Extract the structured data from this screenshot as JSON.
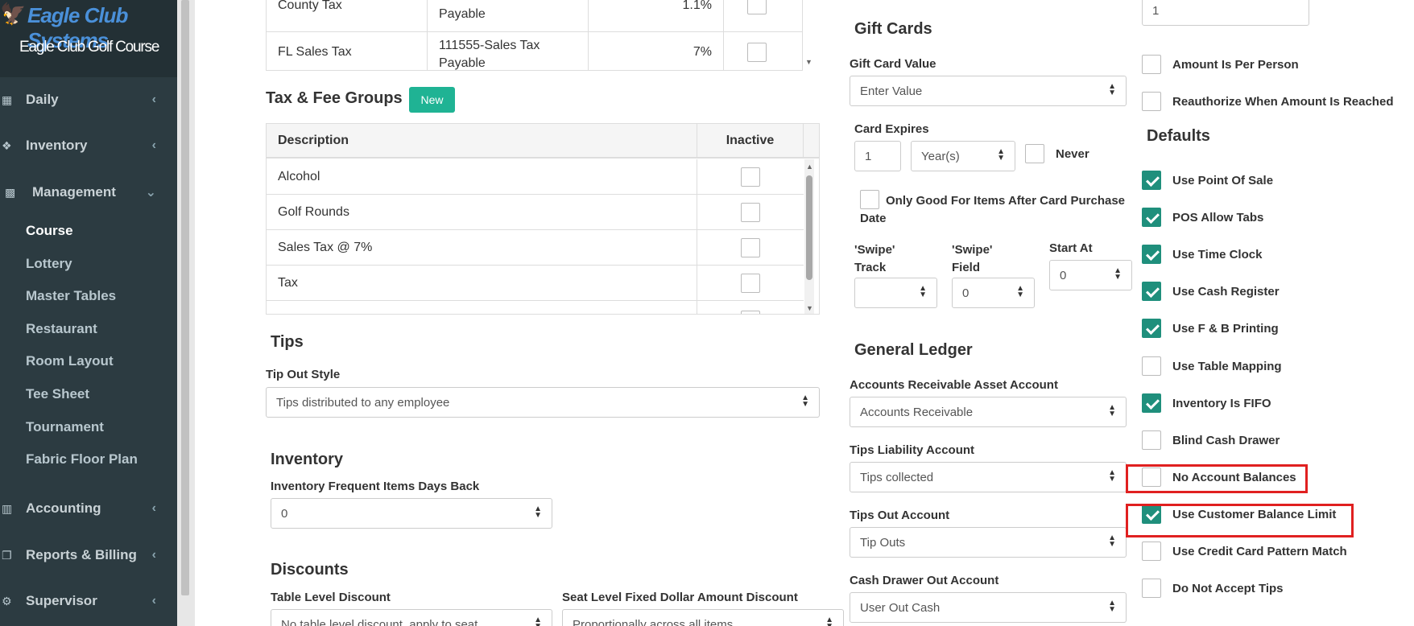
{
  "app": {
    "brand_title": "Eagle Club Systems",
    "brand_subtitle": "Eagle Club Golf Course"
  },
  "sidebar": {
    "items": [
      {
        "label": "Daily",
        "icon": "calendar-icon"
      },
      {
        "label": "Inventory",
        "icon": "cubes-icon"
      },
      {
        "label": "Management",
        "icon": "dashboard-icon"
      },
      {
        "label": "Accounting",
        "icon": "bar-chart-icon"
      },
      {
        "label": "Reports & Billing",
        "icon": "copy-icon"
      },
      {
        "label": "Supervisor",
        "icon": "gear-icon"
      }
    ],
    "sub_items": [
      "Course",
      "Lottery",
      "Master Tables",
      "Restaurant",
      "Room Layout",
      "Tee Sheet",
      "Tournament",
      "Fabric Floor Plan"
    ]
  },
  "tax_table": {
    "rows": [
      {
        "name": "County Tax",
        "account": "Payable",
        "rate": "1.1%"
      },
      {
        "name": "FL Sales Tax",
        "account": "111555-Sales Tax Payable",
        "rate": "7%"
      }
    ]
  },
  "tax_fee_groups": {
    "title": "Tax & Fee Groups",
    "new_button": "New",
    "col_description": "Description",
    "col_inactive": "Inactive",
    "rows": [
      "Alcohol",
      "Golf Rounds",
      "Sales Tax @ 7%",
      "Tax"
    ]
  },
  "tips": {
    "title": "Tips",
    "style_label": "Tip Out Style",
    "style_value": "Tips distributed to any employee"
  },
  "inventory": {
    "title": "Inventory",
    "days_back_label": "Inventory Frequent Items Days Back",
    "days_back_value": "0"
  },
  "discounts": {
    "title": "Discounts",
    "table_label": "Table Level Discount",
    "table_value": "No table level discount, apply to seat",
    "seat_label": "Seat Level Fixed Dollar Amount Discount",
    "seat_value": "Proportionally across all items"
  },
  "gift_cards": {
    "title": "Gift Cards",
    "value_label": "Gift Card Value",
    "value_placeholder": "Enter Value",
    "expires_label": "Card Expires",
    "expires_value": "1",
    "expires_unit": "Year(s)",
    "never_label": "Never",
    "only_good_label": "Only Good For Items After Card Purchase Date",
    "swipe_track_label": "'Swipe' Track",
    "swipe_field_label": "'Swipe' Field",
    "swipe_field_value": "0",
    "start_at_label": "Start At",
    "start_at_value": "0"
  },
  "general_ledger": {
    "title": "General Ledger",
    "ar_label": "Accounts Receivable Asset Account",
    "ar_value": "Accounts Receivable",
    "tips_liability_label": "Tips Liability Account",
    "tips_liability_value": "Tips collected",
    "tips_out_label": "Tips Out Account",
    "tips_out_value": "Tip Outs",
    "cash_drawer_label": "Cash Drawer Out Account",
    "cash_drawer_value": "User Out Cash"
  },
  "right_column": {
    "top_value": "1",
    "amount_per_person": "Amount Is Per Person",
    "reauthorize": "Reauthorize When Amount Is Reached",
    "defaults_title": "Defaults",
    "defaults": [
      {
        "label": "Use Point Of Sale",
        "checked": true
      },
      {
        "label": "POS Allow Tabs",
        "checked": true
      },
      {
        "label": "Use Time Clock",
        "checked": true
      },
      {
        "label": "Use Cash Register",
        "checked": true
      },
      {
        "label": "Use F & B Printing",
        "checked": true
      },
      {
        "label": "Use Table Mapping",
        "checked": false
      },
      {
        "label": "Inventory Is FIFO",
        "checked": true
      },
      {
        "label": "Blind Cash Drawer",
        "checked": false
      },
      {
        "label": "No Account Balances",
        "checked": false
      },
      {
        "label": "Use Customer Balance Limit",
        "checked": true
      },
      {
        "label": "Use Credit Card Pattern Match",
        "checked": false
      },
      {
        "label": "Do Not Accept Tips",
        "checked": false
      }
    ]
  },
  "colors": {
    "sidebar_bg": "#2c3b41",
    "accent_green": "#1fb394",
    "checkbox_checked": "#1f8f7c",
    "highlight_red": "#e02020"
  }
}
